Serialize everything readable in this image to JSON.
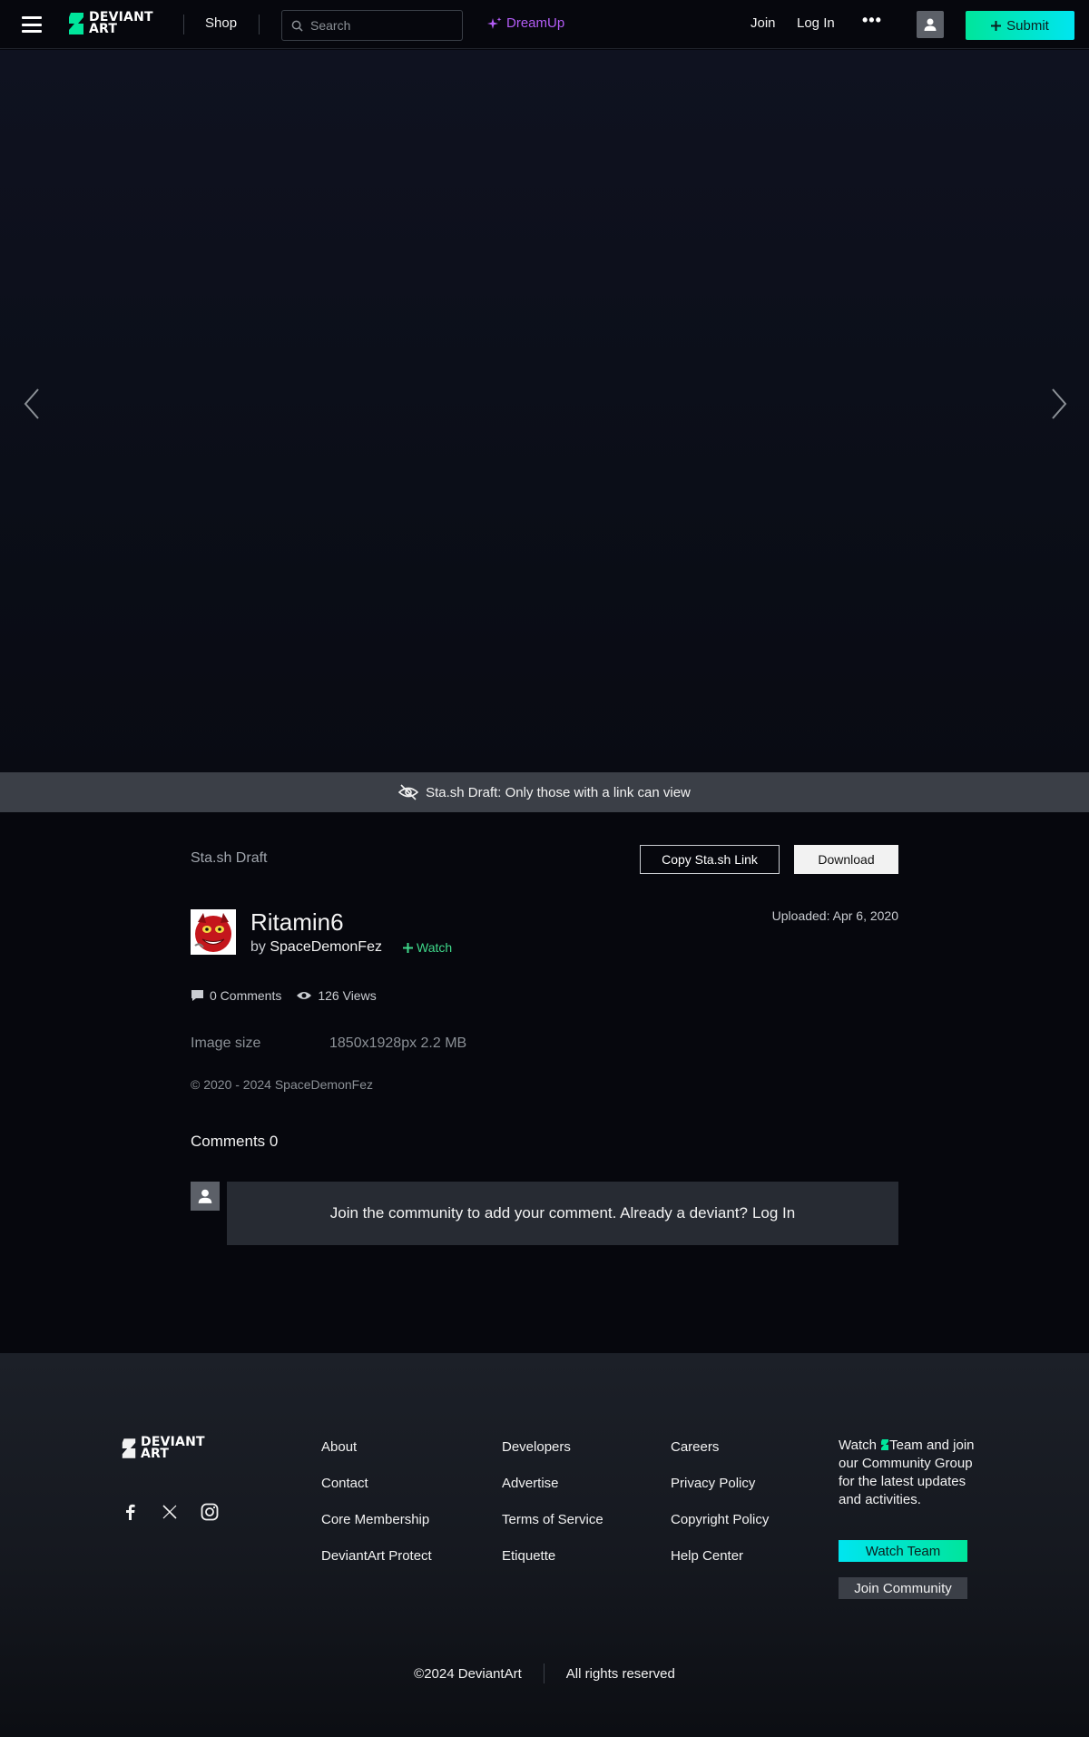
{
  "nav": {
    "logo_line1": "DEVIANT",
    "logo_line2": "ART",
    "shop": "Shop",
    "search_placeholder": "Search",
    "dreamup": "DreamUp",
    "join": "Join",
    "login": "Log In",
    "more": "•••",
    "submit": "Submit"
  },
  "banner": {
    "text": "Sta.sh Draft: Only those with a link can view"
  },
  "deviation": {
    "stash_label": "Sta.sh Draft",
    "copy_link": "Copy Sta.sh Link",
    "download": "Download",
    "title": "Ritamin6",
    "by": "by",
    "author": "SpaceDemonFez",
    "watch": "Watch",
    "uploaded": "Uploaded: Apr 6, 2020",
    "comments_count": "0 Comments",
    "views_count": "126 Views",
    "image_size_label": "Image size",
    "image_size_value": "1850x1928px 2.2 MB",
    "copyright": "© 2020 - 2024 SpaceDemonFez"
  },
  "comments": {
    "heading": "Comments 0",
    "prompt": "Join the community to add your comment. Already a deviant?",
    "login": "Log In"
  },
  "footer": {
    "logo_line1": "DEVIANT",
    "logo_line2": "ART",
    "col1": [
      "About",
      "Contact",
      "Core Membership",
      "DeviantArt Protect"
    ],
    "col2": [
      "Developers",
      "Advertise",
      "Terms of Service",
      "Etiquette"
    ],
    "col3": [
      "Careers",
      "Privacy Policy",
      "Copyright Policy",
      "Help Center"
    ],
    "team_text_pre": "Watch",
    "team_text_post": "Team and join our Community Group for the latest updates and activities.",
    "watch_team": "Watch Team",
    "join_community": "Join Community",
    "copyright": "©2024 DeviantArt",
    "rights": "All rights reserved"
  },
  "colors": {
    "brand_green": "#00e59b",
    "brand_cyan": "#00e5f0",
    "dreamup_purple": "#b35cf6",
    "watch_green": "#3fd88a"
  }
}
